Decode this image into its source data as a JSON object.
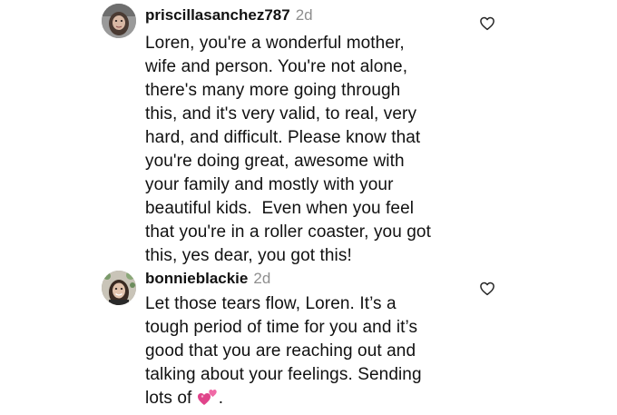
{
  "comments": [
    {
      "username": "priscillasanchez787",
      "time": "2d",
      "lines": [
        "Loren, you're a wonderful mother,",
        "wife and person. You're not alone,",
        "there's many more going through",
        "this, and it's very valid, to real, very",
        "hard, and difficult. Please know that",
        "you're doing great, awesome with",
        "your family and mostly with your",
        "beautiful kids.  Even when you feel",
        "that you're in a roller coaster, you got",
        "this, yes dear, you got this!"
      ],
      "like_icon": "heart-outline-icon"
    },
    {
      "username": "bonnieblackie",
      "time": "2d",
      "lines": [
        "Let those tears flow, Loren. It’s a",
        "tough period of time for you and it’s",
        "good that you are reaching out and",
        "talking about your feelings. Sending"
      ],
      "last_line_prefix": "lots of ",
      "last_line_suffix": ".",
      "emoji": "two-hearts-emoji",
      "like_icon": "heart-outline-icon"
    }
  ]
}
